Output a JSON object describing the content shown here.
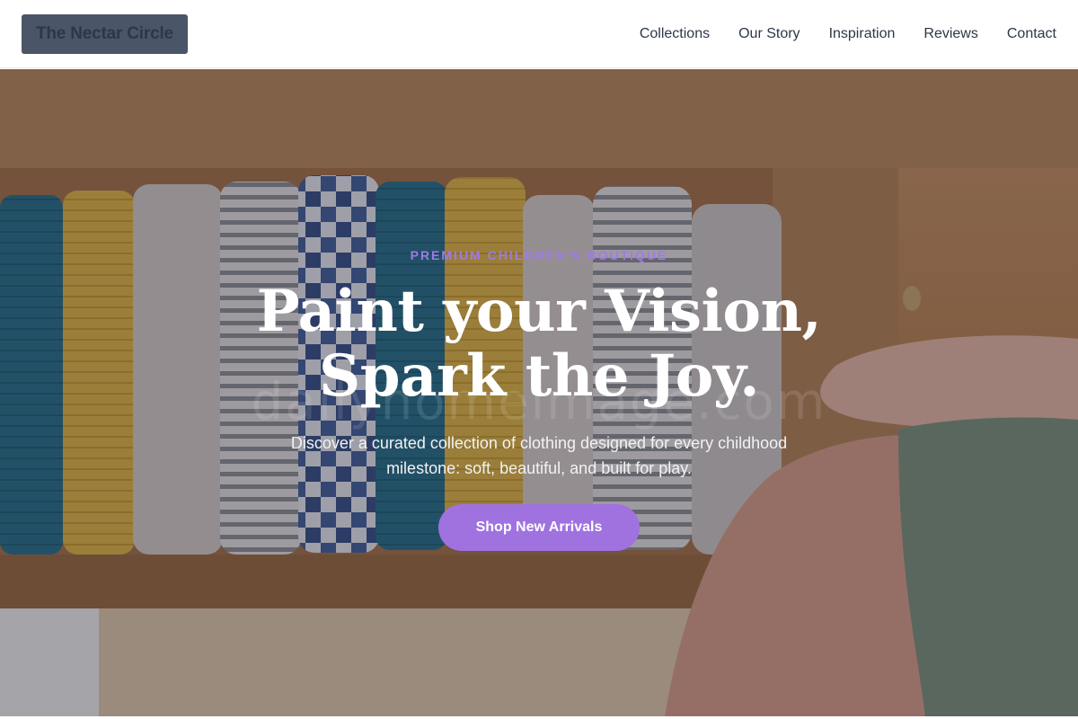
{
  "brand": {
    "name": "The Nectar Circle"
  },
  "nav": {
    "items": [
      {
        "label": "Collections"
      },
      {
        "label": "Our Story"
      },
      {
        "label": "Inspiration"
      },
      {
        "label": "Reviews"
      },
      {
        "label": "Contact"
      }
    ]
  },
  "hero": {
    "eyebrow": "PREMIUM CHILDREN'S BOUTIQUE",
    "headline_line1": "Paint your Vision,",
    "headline_line2": "Spark the Joy.",
    "subtitle": "Discover a curated collection of clothing designed for every childhood milestone: soft, beautiful, and built for play.",
    "cta_label": "Shop New Arrivals",
    "image_alt": "Hands arranging folded muslin baby blankets in a wooden drawer"
  },
  "colors": {
    "accent": "#9f72e0",
    "eyebrow": "#9f7aea",
    "nav_text": "#2d3748",
    "logo_bg": "#4a5568"
  }
}
